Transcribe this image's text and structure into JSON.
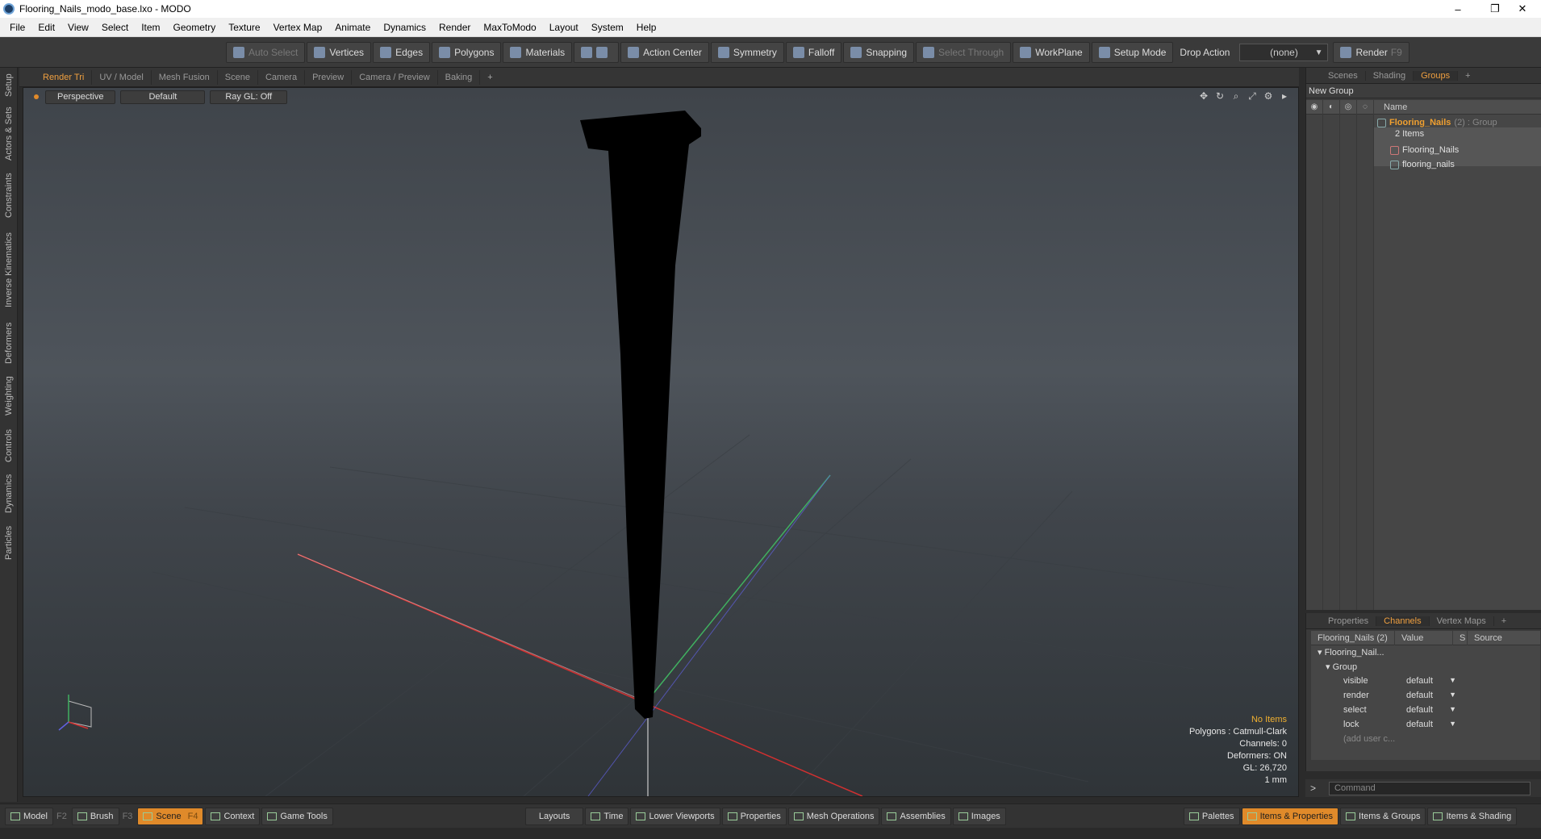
{
  "window": {
    "title": "Flooring_Nails_modo_base.lxo - MODO",
    "minimize": "–",
    "maximize": "❐",
    "close": "✕"
  },
  "menu": [
    "File",
    "Edit",
    "View",
    "Select",
    "Item",
    "Geometry",
    "Texture",
    "Vertex Map",
    "Animate",
    "Dynamics",
    "Render",
    "MaxToModo",
    "Layout",
    "System",
    "Help"
  ],
  "toolbar": {
    "auto_select": "Auto Select",
    "vertices": "Vertices",
    "edges": "Edges",
    "polygons": "Polygons",
    "materials": "Materials",
    "action_center": "Action Center",
    "symmetry": "Symmetry",
    "falloff": "Falloff",
    "snapping": "Snapping",
    "select_through": "Select Through",
    "workplane": "WorkPlane",
    "setup_mode": "Setup Mode",
    "drop_action": "Drop Action",
    "drop_value": "(none)",
    "render": "Render",
    "render_key": "F9"
  },
  "left_tabs": [
    "Setup",
    "Actors & Sets",
    "Constraints",
    "Inverse Kinematics",
    "Deformers",
    "Weighting",
    "Controls",
    "Dynamics",
    "Particles"
  ],
  "viewport": {
    "tabs": [
      "Render Tri",
      "UV / Model",
      "Mesh Fusion",
      "Scene",
      "Camera",
      "Preview",
      "Camera / Preview",
      "Baking"
    ],
    "plus": "+",
    "header": {
      "perspective": "Perspective",
      "shading": "Default",
      "raygl": "Ray GL: Off"
    },
    "info": {
      "items": "No Items",
      "polygons": "Polygons : Catmull-Clark",
      "channels": "Channels: 0",
      "deformers": "Deformers: ON",
      "gl": "GL: 26,720",
      "scale": "1 mm"
    }
  },
  "groups_panel": {
    "tabs": [
      "Scenes",
      "Shading",
      "Groups"
    ],
    "plus": "+",
    "new_group": "New Group",
    "name_header": "Name",
    "group_name": "Flooring_Nails",
    "group_suffix": "(2) : Group",
    "group_count": "2 Items",
    "children": [
      "Flooring_Nails",
      "flooring_nails"
    ]
  },
  "channels_panel": {
    "tabs": [
      "Properties",
      "Channels",
      "Vertex Maps"
    ],
    "plus": "+",
    "headers": {
      "item": "Flooring_Nails (2)",
      "value": "Value",
      "s": "S",
      "source": "Source"
    },
    "root": "Flooring_Nail...",
    "group": "Group",
    "rows": [
      {
        "name": "visible",
        "value": "default"
      },
      {
        "name": "render",
        "value": "default"
      },
      {
        "name": "select",
        "value": "default"
      },
      {
        "name": "lock",
        "value": "default"
      }
    ],
    "add_user": "(add user c..."
  },
  "command": {
    "prompt": ">",
    "placeholder": "Command"
  },
  "bottombar": {
    "model": "Model",
    "model_key": "F2",
    "brush": "Brush",
    "brush_key": "F3",
    "scene": "Scene",
    "scene_key": "F4",
    "context": "Context",
    "game_tools": "Game Tools",
    "layouts": "Layouts",
    "time": "Time",
    "lower_viewports": "Lower Viewports",
    "properties": "Properties",
    "mesh_operations": "Mesh Operations",
    "assemblies": "Assemblies",
    "images": "Images",
    "palettes": "Palettes",
    "items_properties": "Items & Properties",
    "items_groups": "Items & Groups",
    "items_shading": "Items & Shading"
  },
  "colors": {
    "accent": "#e08a2a",
    "warning_text": "#f0b030",
    "axis_x": "#d03030",
    "axis_y": "#40b060",
    "axis_z": "#6060e0"
  }
}
